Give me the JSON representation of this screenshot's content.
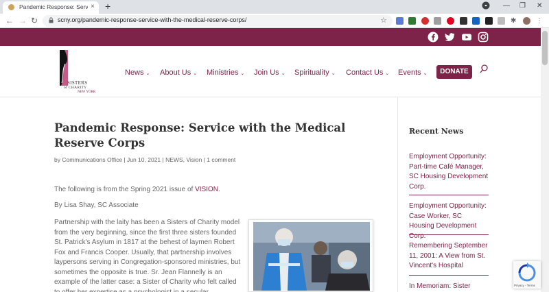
{
  "browser": {
    "tab_title": "Pandemic Response: Service with the Medical Reserve Corps",
    "new_tab": "+",
    "tab_close": "×",
    "url": "scny.org/pandemic-response-service-with-the-medical-reserve-corps/",
    "window_controls": {
      "minimize": "—",
      "restore": "❐",
      "close": "✕"
    },
    "nav": {
      "back": "←",
      "forward": "→",
      "reload": "↻"
    }
  },
  "social": {
    "icons": [
      "facebook-icon",
      "twitter-icon",
      "youtube-icon",
      "instagram-icon"
    ]
  },
  "logo": {
    "line1": "SISTERS",
    "line2": "of CHARITY",
    "line3": "NEW YORK"
  },
  "nav": {
    "items": [
      {
        "label": "News"
      },
      {
        "label": "About Us"
      },
      {
        "label": "Ministries"
      },
      {
        "label": "Join Us"
      },
      {
        "label": "Spirituality"
      },
      {
        "label": "Contact Us"
      },
      {
        "label": "Events"
      }
    ],
    "donate": "DONATE"
  },
  "post": {
    "title": "Pandemic Response: Service with the Medical Reserve Corps",
    "meta": {
      "by": "by ",
      "author": "Communications Office",
      "date": " | Jun 10, 2021 | ",
      "cat1": "NEWS",
      "sep": ", ",
      "cat2": "Vision",
      "sep2": " | ",
      "comments": "1 comment"
    },
    "intro_before": "The following is from the Spring 2021 issue of ",
    "intro_link": "VISION",
    "intro_after": ".",
    "byline": "By Lisa Shay, SC Associate",
    "body": "Partnership with the laity has been a Sisters of Charity model from the very beginning, since the first three sisters founded St. Patrick's Asylum in 1817 at the behest of laymen Robert Fox and Francis Cooper. Usually, that partnership involves laypersons serving in Congregation-sponsored ministries, but sometimes the opposite is true. Sr. Jean Flannelly is an example of the latter case: a Sister of Charity who felt called to offer her expertise as a psychologist in a secular"
  },
  "sidebar": {
    "heading": "Recent News",
    "items": [
      "Employment Opportunity: Part-time Café Manager, SC Housing Development Corp.",
      "Employment Opportunity: Case Worker, SC Housing Development Corp.",
      "Remembering September 11, 2001: A View from St. Vincent's Hospital",
      "In Memoriam: Sister"
    ]
  },
  "recaptcha": {
    "text": "Privacy - Terms"
  },
  "colors": {
    "brand": "#7d2248",
    "chrome": "#dee1e6"
  }
}
